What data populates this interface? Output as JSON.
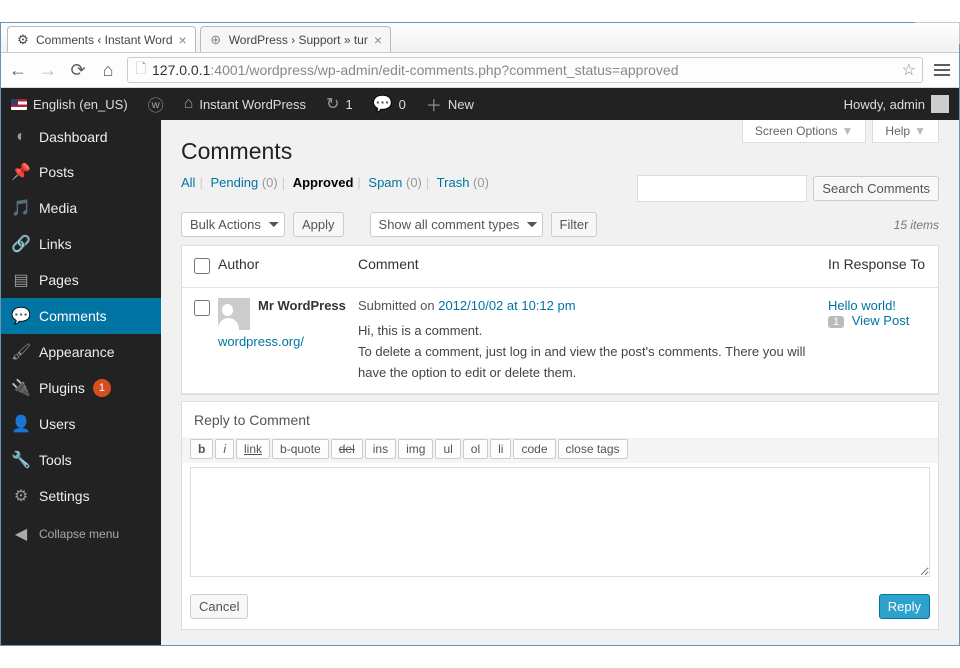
{
  "window": {
    "min": "—",
    "max": "☐",
    "close": "✕"
  },
  "tabs": [
    {
      "title": "Comments ‹ Instant Word",
      "active": true
    },
    {
      "title": "WordPress › Support » tur",
      "active": false
    }
  ],
  "url": {
    "host": "127.0.0.1",
    "port": ":4001",
    "path": "/wordpress/wp-admin/edit-comments.php?comment_status=approved"
  },
  "adminbar": {
    "lang": "English (en_US)",
    "site": "Instant WordPress",
    "updates": "1",
    "comments": "0",
    "new": "New",
    "howdy": "Howdy, admin"
  },
  "screen_tabs": {
    "options": "Screen Options",
    "help": "Help"
  },
  "sidebar": {
    "items": [
      {
        "label": "Dashboard"
      },
      {
        "label": "Posts"
      },
      {
        "label": "Media"
      },
      {
        "label": "Links"
      },
      {
        "label": "Pages"
      },
      {
        "label": "Comments"
      },
      {
        "label": "Appearance"
      },
      {
        "label": "Plugins"
      },
      {
        "label": "Users"
      },
      {
        "label": "Tools"
      },
      {
        "label": "Settings"
      }
    ],
    "plugin_updates": "1",
    "collapse": "Collapse menu"
  },
  "page": {
    "title": "Comments",
    "filters": {
      "all": "All",
      "pending": "Pending",
      "pending_count": "(0)",
      "approved": "Approved",
      "spam": "Spam",
      "spam_count": "(0)",
      "trash": "Trash",
      "trash_count": "(0)"
    },
    "bulk_label": "Bulk Actions",
    "apply": "Apply",
    "type_label": "Show all comment types",
    "filter": "Filter",
    "search_btn": "Search Comments",
    "items_count": "15 items",
    "columns": {
      "author": "Author",
      "comment": "Comment",
      "response": "In Response To"
    },
    "row": {
      "author": "Mr WordPress",
      "author_url": "wordpress.org/",
      "submitted_prefix": "Submitted on ",
      "submitted_date": "2012/10/02 at 10:12 pm",
      "body_1": "Hi, this is a comment.",
      "body_2": "To delete a comment, just log in and view the post's comments. There you will have the option to edit or delete them.",
      "response_post": "Hello world!",
      "response_count": "1",
      "view_post": "View Post"
    },
    "reply": {
      "title": "Reply to Comment",
      "buttons": [
        "b",
        "i",
        "link",
        "b-quote",
        "del",
        "ins",
        "img",
        "ul",
        "ol",
        "li",
        "code",
        "close tags"
      ],
      "cancel": "Cancel",
      "submit": "Reply"
    }
  }
}
